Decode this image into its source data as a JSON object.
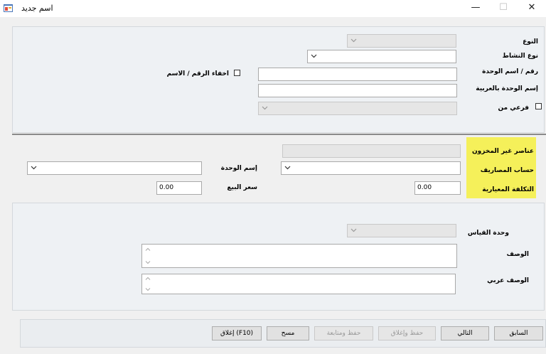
{
  "window": {
    "title": "اسم جديد",
    "minimize_glyph": "—",
    "maximize_glyph": "☐",
    "close_glyph": "✕"
  },
  "top": {
    "type_label": "النوع",
    "activity_label": "نوع النشاط",
    "unit_number_label": "رقم / اسم الوحدة",
    "unit_name_ar_label": "إسم الوحدة بالعربية",
    "sub_of_label": "فرعي من",
    "hide_number_label": "اخفاء الرقم / الاسم",
    "unit_number_value": "",
    "unit_name_value": "",
    "unit_name_ar_value": ""
  },
  "middle": {
    "non_inventory_label": "عناصر غير المخزون",
    "expense_account_label": "حساب المصاريف",
    "standard_cost_label": "التكلفة المعيارية",
    "unit_name_label": "إسم الوحدة",
    "sale_price_label": "سعر البيع",
    "standard_cost_value": "0.00",
    "sale_price_value": "0.00"
  },
  "bottom": {
    "measure_unit_label": "وحدة القياس",
    "description_label": "الوصف",
    "description_ar_label": "الوصف عربي"
  },
  "footer": {
    "previous_label": "السابق",
    "next_label": "التالي",
    "save_close_label": "حفظ وإغلاق",
    "save_continue_label": "حفظ ومتابعة",
    "clear_label": "مسح",
    "close_label": "إغلاق (F10)"
  }
}
